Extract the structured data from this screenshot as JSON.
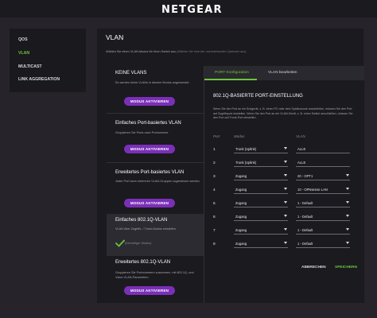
{
  "brand": {
    "logo_text": "NETGEAR"
  },
  "sidebar": {
    "items": [
      {
        "label": "QOS"
      },
      {
        "label": "VLAN"
      },
      {
        "label": "MULTICAST"
      },
      {
        "label": "LINK AGGREGATION"
      }
    ]
  },
  "main": {
    "title": "VLAN",
    "subtitle": "Wählen Sie einen VLAN-Modus für Ihren Switch aus",
    "subtitle_hint": "(Wählen Sie eine der nachstehenden Optionen aus)"
  },
  "modes": [
    {
      "title": "KEINE VLANS",
      "desc": "Es werden keine VLANs in diesem Modus angewendet.",
      "button": "MODUS AKTIVIEREN"
    },
    {
      "title": "Einfaches Port-basiertes VLAN",
      "desc": "Gruppieren Sie Ports nach Portnummer",
      "button": "MODUS AKTIVIEREN"
    },
    {
      "title": "Erweitertes Port-basiertes VLAN",
      "desc": "Jeder Port kann mehreren VLAN-Gruppen zugewiesen werden",
      "button": "MODUS AKTIVIEREN"
    },
    {
      "title": "Einfaches 802.1Q-VLAN",
      "desc": "VLAN über Zugriffs- / Trunk-Modus einstellen",
      "current": "(Derzeitiger Modus)"
    },
    {
      "title": "Erweitertes 802.1Q-VLAN",
      "desc": "Gruppieren Sie Portnummern zusammen, mit 802.1Q- und Voice-VLAN-Parametern",
      "button": "MODUS AKTIVIEREN"
    }
  ],
  "panel": {
    "tabs": [
      {
        "label": "PORT-Konfiguration"
      },
      {
        "label": "VLAN bearbeiten"
      }
    ],
    "heading": "802.1Q-BASIERTE PORT-EINSTELLUNG",
    "desc": "Wenn Sie den Port an ein Endgerät, z. B. einen PC oder eine Spielkonsole anschließen, müssen Sie den Port auf Zugriffsport einstellen. Wenn Sie den Port an ein VLAN-Gerät, z. B. einen Switch anschließen, müssen Sie den Port auf Trunk-Port einstellen.",
    "columns": {
      "port": "Port",
      "mode": "Modus",
      "vlan": "VLAN"
    },
    "rows": [
      {
        "port": "1",
        "mode": "Trunk (Uplink)",
        "vlan": "ALLE"
      },
      {
        "port": "2",
        "mode": "Trunk (Uplink)",
        "vlan": "ALLE"
      },
      {
        "port": "3",
        "mode": "Zugang",
        "vlan": "20 - OPT1"
      },
      {
        "port": "4",
        "mode": "Zugang",
        "vlan": "10 - OPNsense LAN"
      },
      {
        "port": "5",
        "mode": "Zugang",
        "vlan": "1 - Default"
      },
      {
        "port": "6",
        "mode": "Zugang",
        "vlan": "1 - Default"
      },
      {
        "port": "7",
        "mode": "Zugang",
        "vlan": "1 - Default"
      },
      {
        "port": "8",
        "mode": "Zugang",
        "vlan": "1 - Default"
      }
    ],
    "cancel": "ABBRECHEN",
    "save": "SPEICHERN"
  },
  "colors": {
    "accent_green": "#6ec33c",
    "accent_purple": "#7b2fb8"
  }
}
